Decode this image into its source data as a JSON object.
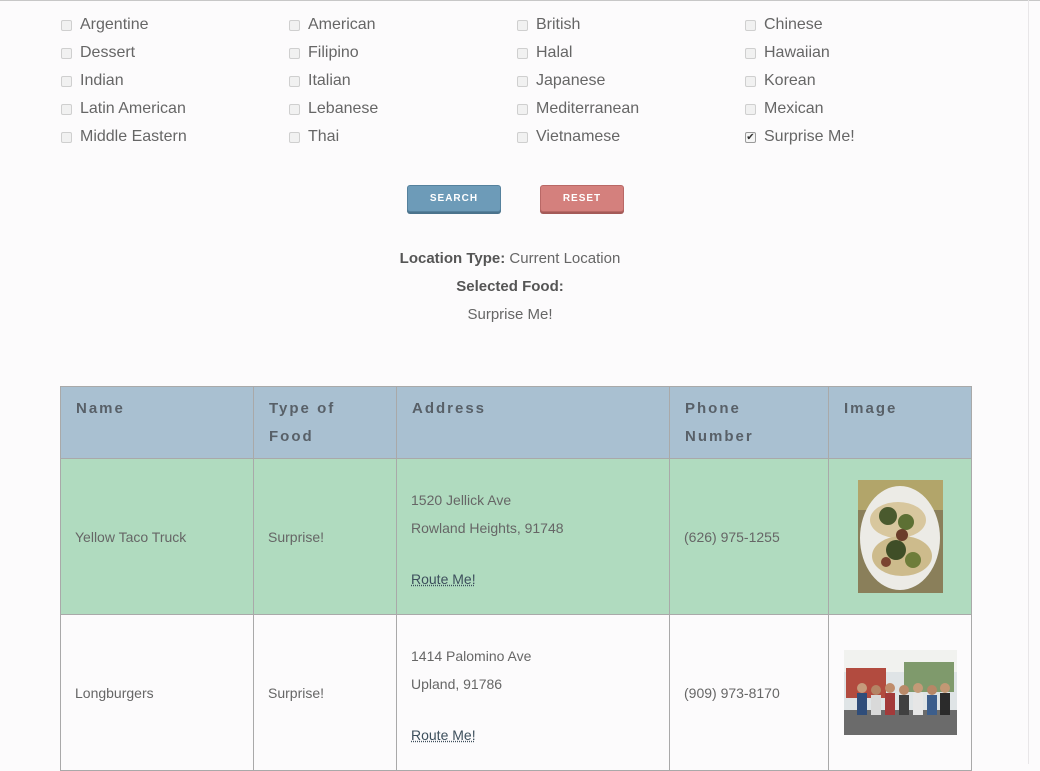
{
  "cuisines": [
    {
      "label": "Argentine",
      "checked": false
    },
    {
      "label": "American",
      "checked": false
    },
    {
      "label": "British",
      "checked": false
    },
    {
      "label": "Chinese",
      "checked": false
    },
    {
      "label": "Dessert",
      "checked": false
    },
    {
      "label": "Filipino",
      "checked": false
    },
    {
      "label": "Halal",
      "checked": false
    },
    {
      "label": "Hawaiian",
      "checked": false
    },
    {
      "label": "Indian",
      "checked": false
    },
    {
      "label": "Italian",
      "checked": false
    },
    {
      "label": "Japanese",
      "checked": false
    },
    {
      "label": "Korean",
      "checked": false
    },
    {
      "label": "Latin American",
      "checked": false
    },
    {
      "label": "Lebanese",
      "checked": false
    },
    {
      "label": "Mediterranean",
      "checked": false
    },
    {
      "label": "Mexican",
      "checked": false
    },
    {
      "label": "Middle Eastern",
      "checked": false
    },
    {
      "label": "Thai",
      "checked": false
    },
    {
      "label": "Vietnamese",
      "checked": false
    },
    {
      "label": "Surprise Me!",
      "checked": true
    }
  ],
  "buttons": {
    "search": "SEARCH",
    "reset": "RESET"
  },
  "summary": {
    "location_label": "Location Type:",
    "location_value": "Current Location",
    "food_label": "Selected Food:",
    "food_value": "Surprise Me!"
  },
  "table": {
    "headers": {
      "name": "Name",
      "type": "Type of Food",
      "address": "Address",
      "phone": "Phone Number",
      "image": "Image"
    },
    "rows": [
      {
        "name": "Yellow Taco Truck",
        "type": "Surprise!",
        "street": "1520 Jellick Ave",
        "city": "Rowland Heights, 91748",
        "route": "Route Me!",
        "phone": "(626) 975-1255",
        "image_icon": "tacos-photo-icon"
      },
      {
        "name": "Longburgers",
        "type": "Surprise!",
        "street": "1414 Palomino Ave",
        "city": "Upland, 91786",
        "route": "Route Me!",
        "phone": "(909) 973-8170",
        "image_icon": "food-truck-crowd-photo-icon"
      }
    ]
  },
  "colors": {
    "header_bg": "#a9c0d1",
    "row_highlight": "#b0dbbf",
    "search_button": "#6d9bb8",
    "reset_button": "#d4807d"
  }
}
